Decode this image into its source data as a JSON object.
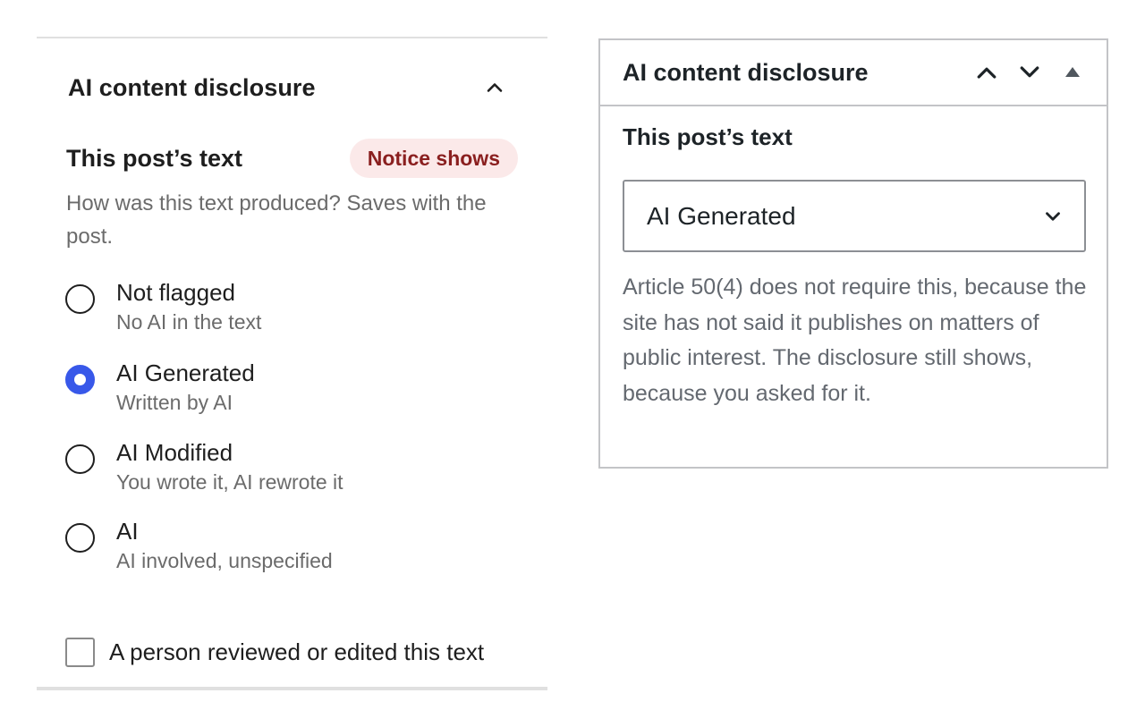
{
  "block_panel": {
    "title": "AI content disclosure",
    "section_title": "This post’s text",
    "badge": "Notice shows",
    "help": "How was this text produced? Saves with the post.",
    "options": [
      {
        "label": "Not flagged",
        "description": "No AI in the text",
        "checked": false
      },
      {
        "label": "AI Generated",
        "description": "Written by AI",
        "checked": true
      },
      {
        "label": "AI Modified",
        "description": "You wrote it, AI rewrote it",
        "checked": false
      },
      {
        "label": "AI",
        "description": "AI involved, unspecified",
        "checked": false
      }
    ],
    "checkbox_label": "A person reviewed or edited this text",
    "checkbox_checked": false,
    "colors": {
      "accent": "#3858e9",
      "badge_bg": "#fbe9e9",
      "badge_text": "#8a1f1f"
    }
  },
  "meta_box": {
    "title": "AI content disclosure",
    "section_title": "This post’s text",
    "selected": "AI Generated",
    "note": "Article 50(4) does not require this, because the site has not said it publishes on matters of public interest. The disclosure still shows, because you asked for it.",
    "icons": [
      "chevron-up-icon",
      "chevron-down-icon",
      "triangle-up-icon"
    ]
  }
}
